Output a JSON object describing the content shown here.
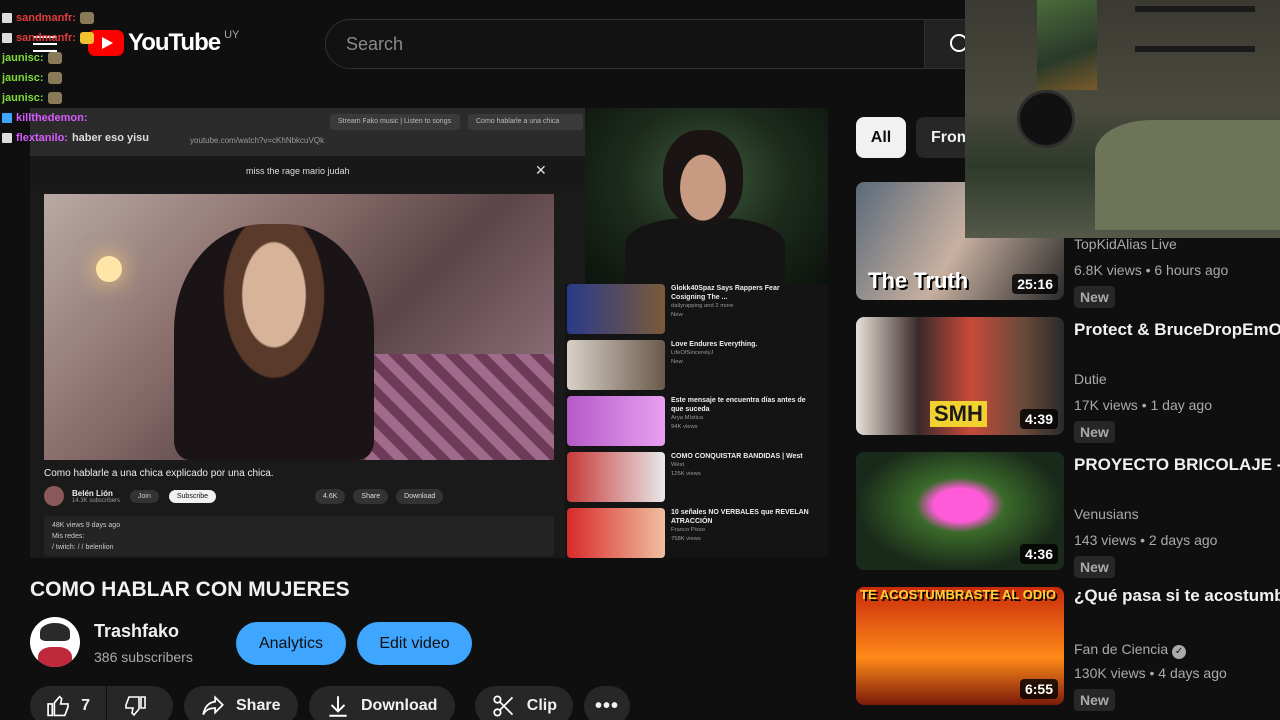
{
  "header": {
    "logo_text": "YouTube",
    "country_code": "UY",
    "search_placeholder": "Search"
  },
  "chat": [
    {
      "user": "sandmanfr:",
      "color": "#e23b3b",
      "text": ""
    },
    {
      "user": "sandmanfr:",
      "color": "#e23b3b",
      "text": ""
    },
    {
      "user": "jaunisc:",
      "color": "#7fdc3c",
      "text": ""
    },
    {
      "user": "jaunisc:",
      "color": "#7fdc3c",
      "text": ""
    },
    {
      "user": "jaunisc:",
      "color": "#7fdc3c",
      "text": ""
    },
    {
      "user": "killthedemon:",
      "color": "#d85cff",
      "text": ""
    },
    {
      "user": "flextanilo:",
      "color": "#d85cff",
      "text": "haber eso yisu"
    }
  ],
  "player": {
    "browser_tabs": [
      "Stream Fako music | Listen to songs",
      "Como hablarle a una chica"
    ],
    "browser_url": "youtube.com/watch?v=cKhNbkcuVQk",
    "search_query": "miss the rage mario judah",
    "inner_title": "Como hablarle a una chica explicado por una chica.",
    "inner_channel": "Belén Lión",
    "inner_subs": "14.3K subscribers",
    "inner_join": "Join",
    "inner_subscribe": "Subscribe",
    "inner_likes": "4.6K",
    "inner_share": "Share",
    "inner_download": "Download",
    "inner_desc_line1": "48K views  9 days ago",
    "inner_desc_line2": "Mis redes:",
    "inner_desc_line3": "/ twitch: /  / belenlion",
    "inner_side": [
      {
        "title": "Glokk40Spaz Says Rappers Fear Cosigning The ...",
        "sub": "dailyrapping and 2 more",
        "badge": "New"
      },
      {
        "title": "Love Endures Everything.",
        "sub": "LifeOfSincerelyJ",
        "badge": "New"
      },
      {
        "title": "Este mensaje te encuentra días antes de que suceda",
        "sub": "Arya Mística",
        "badge": "94K views"
      },
      {
        "title": "COMO CONQUISTAR BANDIDAS | West",
        "sub": "West",
        "badge": "125K views"
      },
      {
        "title": "10 señales NO VERBALES que REVELAN ATRACCIÓN",
        "sub": "Franco Pisso",
        "badge": "758K views"
      }
    ]
  },
  "video": {
    "title": "COMO HABLAR CON MUJERES",
    "channel": "Trashfako",
    "subscribers": "386 subscribers",
    "analytics_label": "Analytics",
    "edit_label": "Edit video",
    "like_count": "7",
    "share_label": "Share",
    "download_label": "Download",
    "clip_label": "Clip"
  },
  "chips": {
    "all": "All",
    "from": "From"
  },
  "recommendations": [
    {
      "title": "",
      "channel": "TopKidAlias Live",
      "meta": "6.8K views • 6 hours ago",
      "badge": "New",
      "duration": "25:16",
      "thumb_text": "The Truth"
    },
    {
      "title": "Protect & BruceDropEmOff Call Out Nine Vicious..",
      "channel": "Dutie",
      "meta": "17K views • 1 day ago",
      "badge": "New",
      "duration": "4:39",
      "thumb_text": "SMH"
    },
    {
      "title": "PROYECTO BRICOLAJE - BRICO ZERO #shoegaze ...",
      "channel": "Venusians",
      "meta": "143 views • 2 days ago",
      "badge": "New",
      "duration": "4:36",
      "thumb_text": ""
    },
    {
      "title": "¿Qué pasa si te acostumbras a ser odiado? (según la ciencia)",
      "channel": "Fan de Ciencia",
      "meta": "130K views • 4 days ago",
      "badge": "New",
      "duration": "6:55",
      "thumb_text": "TE ACOSTUMBRASTE AL ODIO"
    }
  ]
}
